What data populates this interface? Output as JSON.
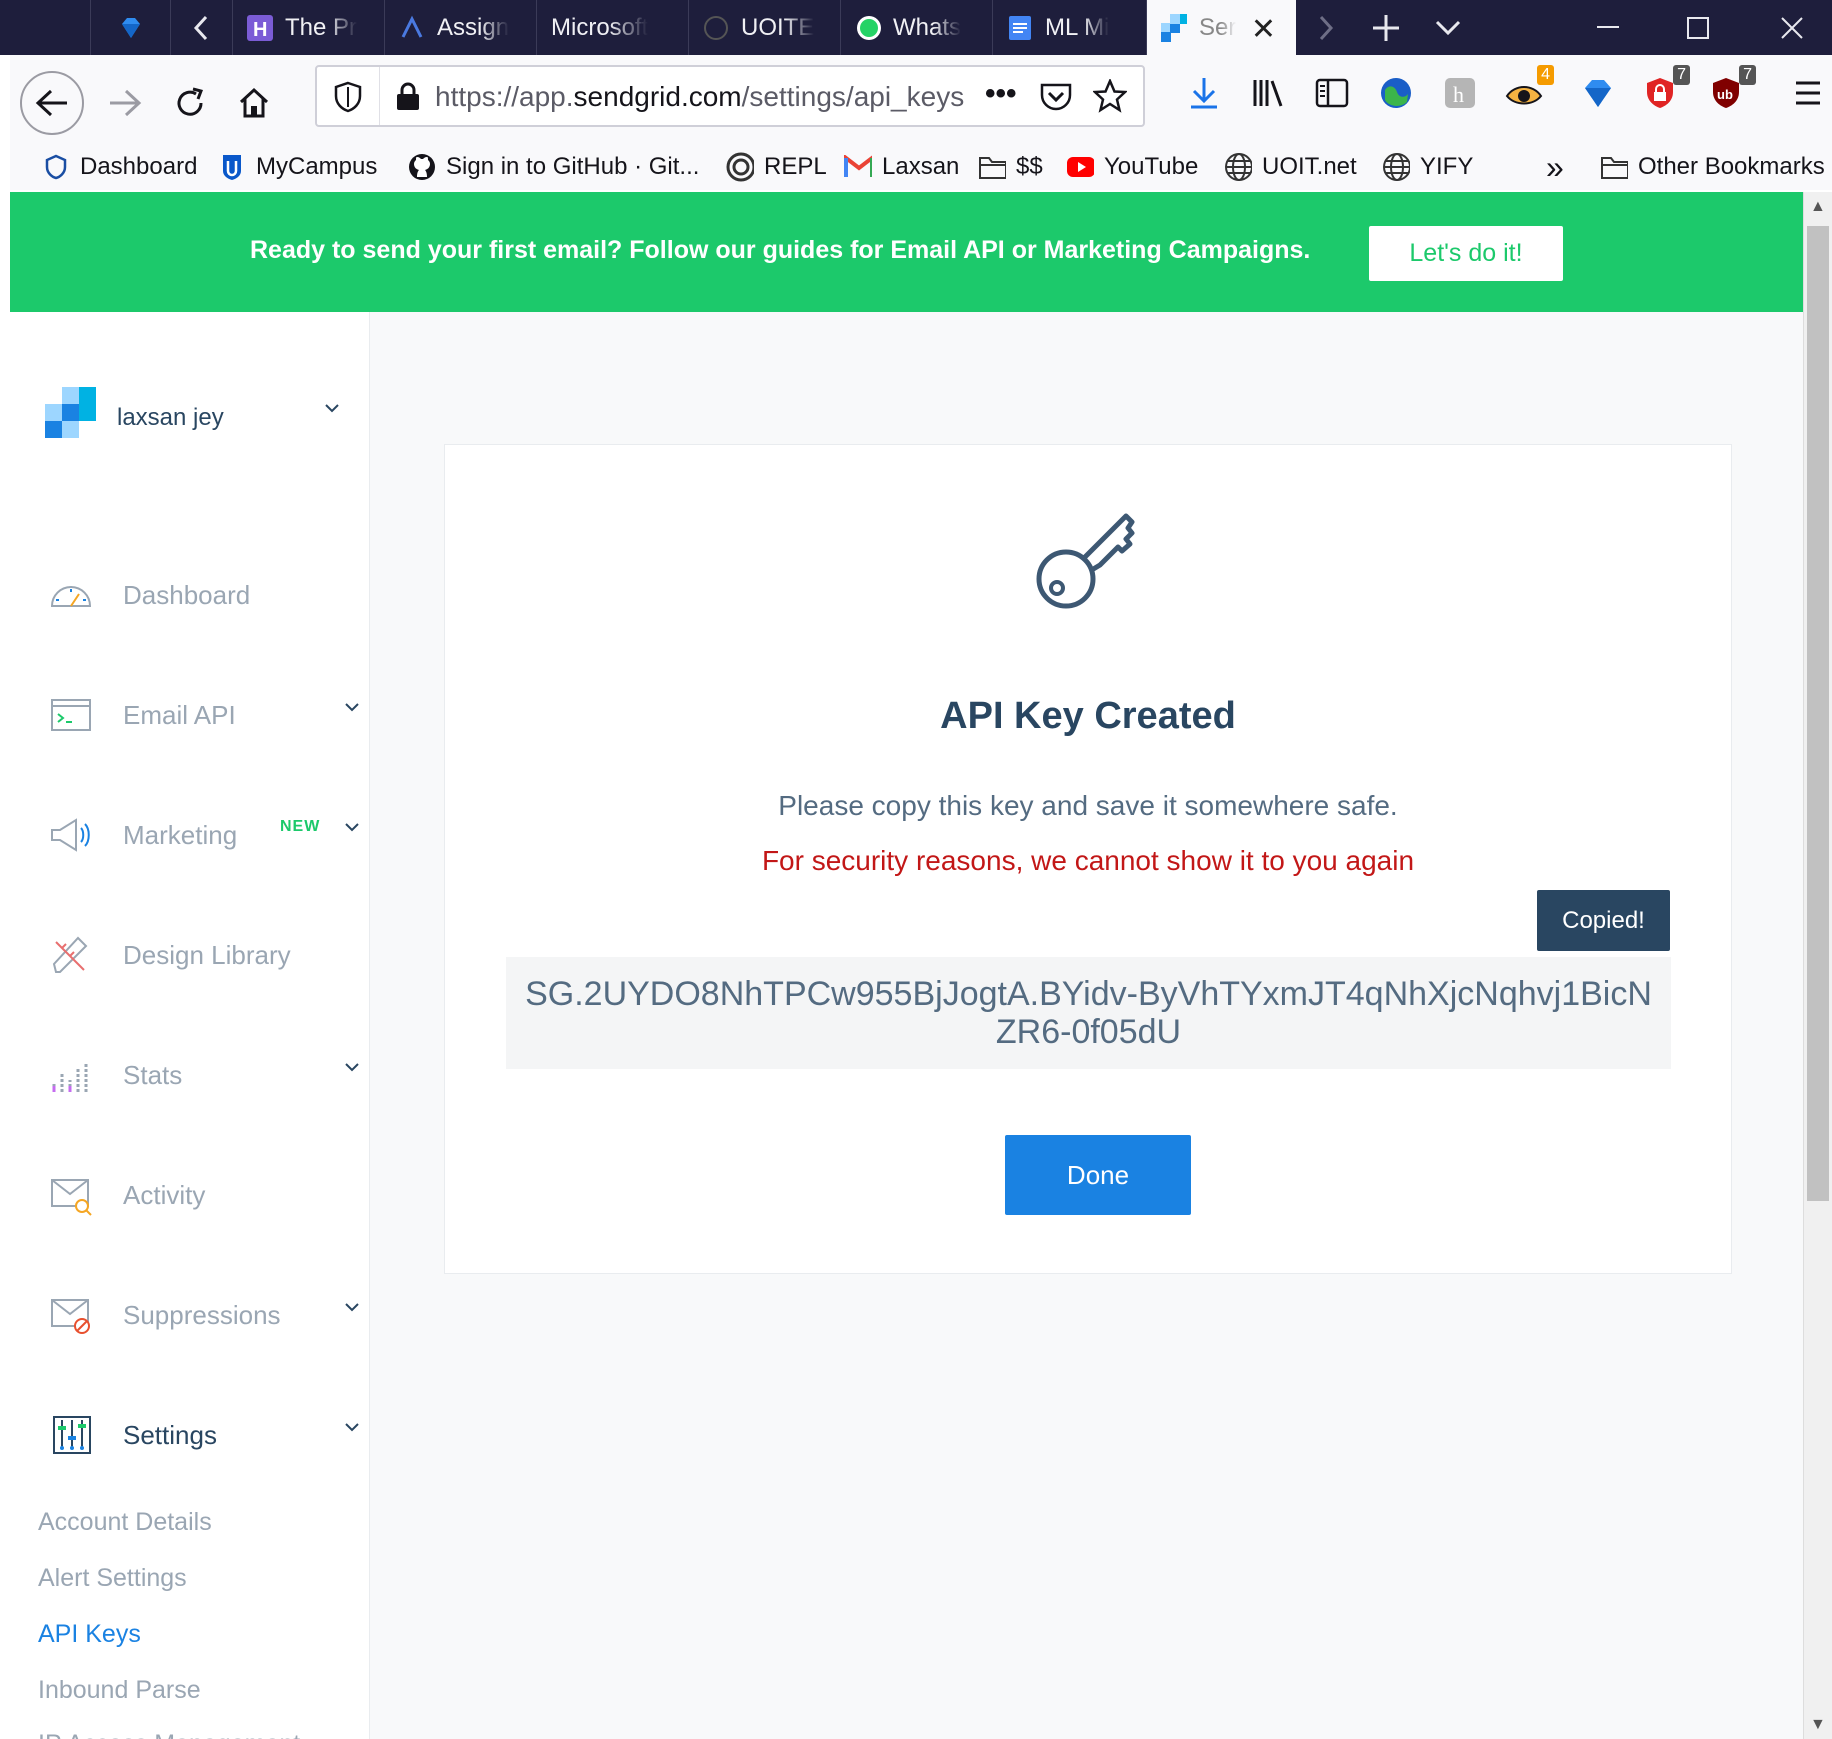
{
  "browser": {
    "tabs": [
      {
        "label": "The Pr",
        "icon": "h-icon"
      },
      {
        "label": "Assign",
        "icon": "assign-icon"
      },
      {
        "label": "Microsoft",
        "icon": "none"
      },
      {
        "label": "UOITE",
        "icon": "github-icon"
      },
      {
        "label": "Whats",
        "icon": "whatsapp-icon"
      },
      {
        "label": "ML Mi",
        "icon": "docs-icon"
      },
      {
        "label": "Ser",
        "icon": "sendgrid-icon"
      }
    ],
    "url_prefix": "https://app.",
    "url_domain": "sendgrid.com",
    "url_path": "/settings/api_keys",
    "badges": {
      "ext1": "4",
      "ext2": "7",
      "ext3": "7"
    },
    "bookmarks": [
      {
        "label": "Dashboard"
      },
      {
        "label": "MyCampus"
      },
      {
        "label": "Sign in to GitHub · Git..."
      },
      {
        "label": "REPL"
      },
      {
        "label": "Laxsan"
      },
      {
        "label": "$$"
      },
      {
        "label": "YouTube"
      },
      {
        "label": "UOIT.net"
      },
      {
        "label": "YIFY"
      }
    ],
    "overflow_label": "»",
    "other_bookmarks": "Other Bookmarks"
  },
  "banner": {
    "text": "Ready to send your first email? Follow our guides for Email API or Marketing Campaigns.",
    "button": "Let's do it!"
  },
  "sidebar": {
    "account_name": "laxsan jey",
    "items": [
      {
        "label": "Dashboard"
      },
      {
        "label": "Email API"
      },
      {
        "label": "Marketing",
        "badge": "NEW"
      },
      {
        "label": "Design Library"
      },
      {
        "label": "Stats"
      },
      {
        "label": "Activity"
      },
      {
        "label": "Suppressions"
      },
      {
        "label": "Settings"
      }
    ],
    "subitems": [
      {
        "label": "Account Details"
      },
      {
        "label": "Alert Settings"
      },
      {
        "label": "API Keys"
      },
      {
        "label": "Inbound Parse"
      },
      {
        "label": "IP Access Management"
      }
    ]
  },
  "card": {
    "title": "API Key Created",
    "message": "Please copy this key and save it somewhere safe.",
    "warning": "For security reasons, we cannot show it to you again",
    "tooltip": "Copied!",
    "api_key": "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",
    "done_button": "Done"
  },
  "colors": {
    "banner_green": "#1cc96b",
    "primary_blue": "#1a82e2",
    "heading_navy": "#294661",
    "warning_red": "#c21717",
    "tabbar_dark": "#1e1e3c"
  }
}
